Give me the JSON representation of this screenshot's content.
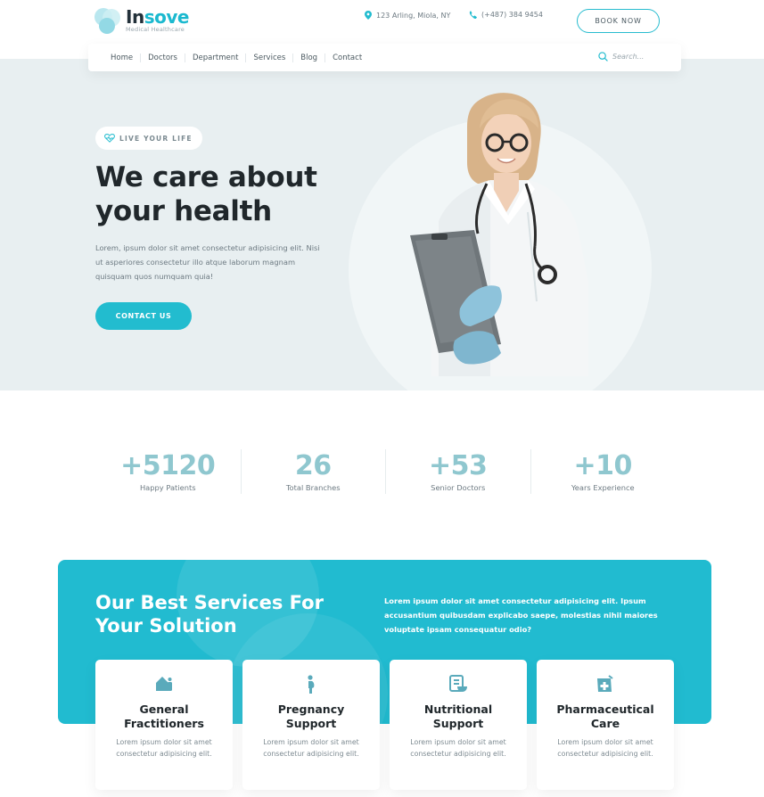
{
  "header": {
    "logo_prefix": "In",
    "logo_accent": "sove",
    "tagline": "Medical Healthcare",
    "address": "123 Arling, Miola, NY",
    "phone": "(+487) 384 9454",
    "book_label": "BOOK NOW"
  },
  "nav": {
    "items": [
      "Home",
      "Doctors",
      "Department",
      "Services",
      "Blog",
      "Contact"
    ],
    "search_placeholder": "Search..."
  },
  "hero": {
    "badge": "LIVE YOUR LIFE",
    "title_line1": "We care about",
    "title_line2": "your health",
    "text": "Lorem, ipsum dolor sit amet consectetur adipisicing elit. Nisi ut asperiores consectetur illo atque laborum magnam quisquam quos numquam quia!",
    "cta": "CONTACT US"
  },
  "stats": [
    {
      "value": "+5120",
      "label": "Happy Patients"
    },
    {
      "value": "26",
      "label": "Total Branches"
    },
    {
      "value": "+53",
      "label": "Senior Doctors"
    },
    {
      "value": "+10",
      "label": "Years Experience"
    }
  ],
  "services": {
    "title": "Our Best Services For Your Solution",
    "text": "Lorem ipsum dolor sit amet consectetur adipisicing elit. Ipsum accusantium quibusdam explicabo saepe, molestias nihil maiores voluptate ipsam consequatur odio?",
    "cards": [
      {
        "icon": "house-icon",
        "title": "General Fractitioners",
        "text": "Lorem ipsum dolor sit amet consectetur adipisicing elit."
      },
      {
        "icon": "pregnant-icon",
        "title": "Pregnancy Support",
        "text": "Lorem ipsum dolor sit amet consectetur adipisicing elit."
      },
      {
        "icon": "nutrition-icon",
        "title": "Nutritional Support",
        "text": "Lorem ipsum dolor sit amet consectetur adipisicing elit."
      },
      {
        "icon": "pharmacy-icon",
        "title": "Pharmaceutical Care",
        "text": "Lorem ipsum dolor sit amet consectetur adipisicing elit."
      }
    ]
  },
  "colors": {
    "accent": "#22bccf",
    "hero_bg": "#e8eff1",
    "stat_number": "#8fc7cf",
    "heading": "#20272b"
  }
}
